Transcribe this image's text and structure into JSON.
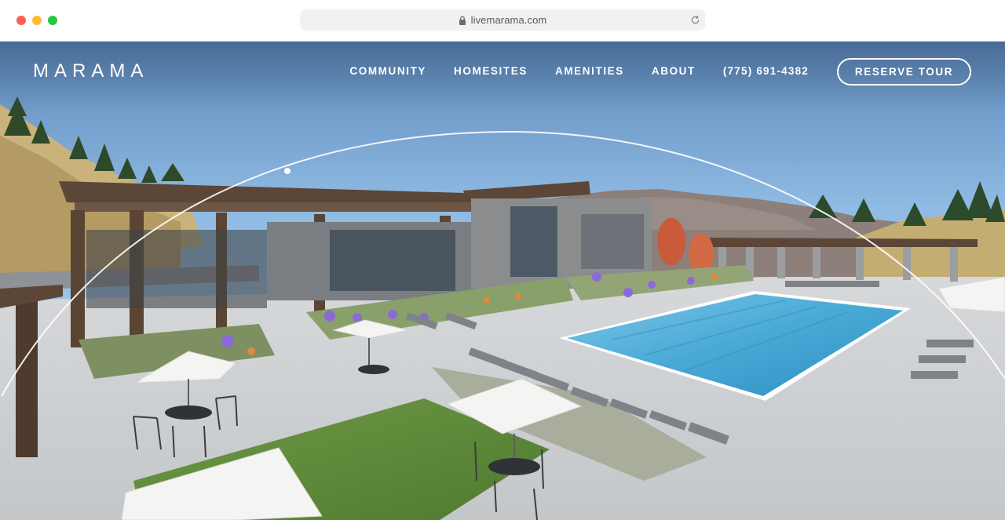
{
  "browser": {
    "url": "livemarama.com",
    "icons": {
      "lock": "lock-icon",
      "reload": "reload-icon"
    }
  },
  "site": {
    "logo": "MARAMA",
    "nav": {
      "community": "COMMUNITY",
      "homesites": "HOMESITES",
      "amenities": "AMENITIES",
      "about": "ABOUT",
      "phone": "(775) 691-4382"
    },
    "cta": "RESERVE TOUR"
  },
  "colors": {
    "traffic_red": "#fe5f57",
    "traffic_yellow": "#febc2e",
    "traffic_green": "#28c840",
    "sky_top": "#5e88b9",
    "pool": "#48a9d6",
    "text_white": "#ffffff"
  }
}
